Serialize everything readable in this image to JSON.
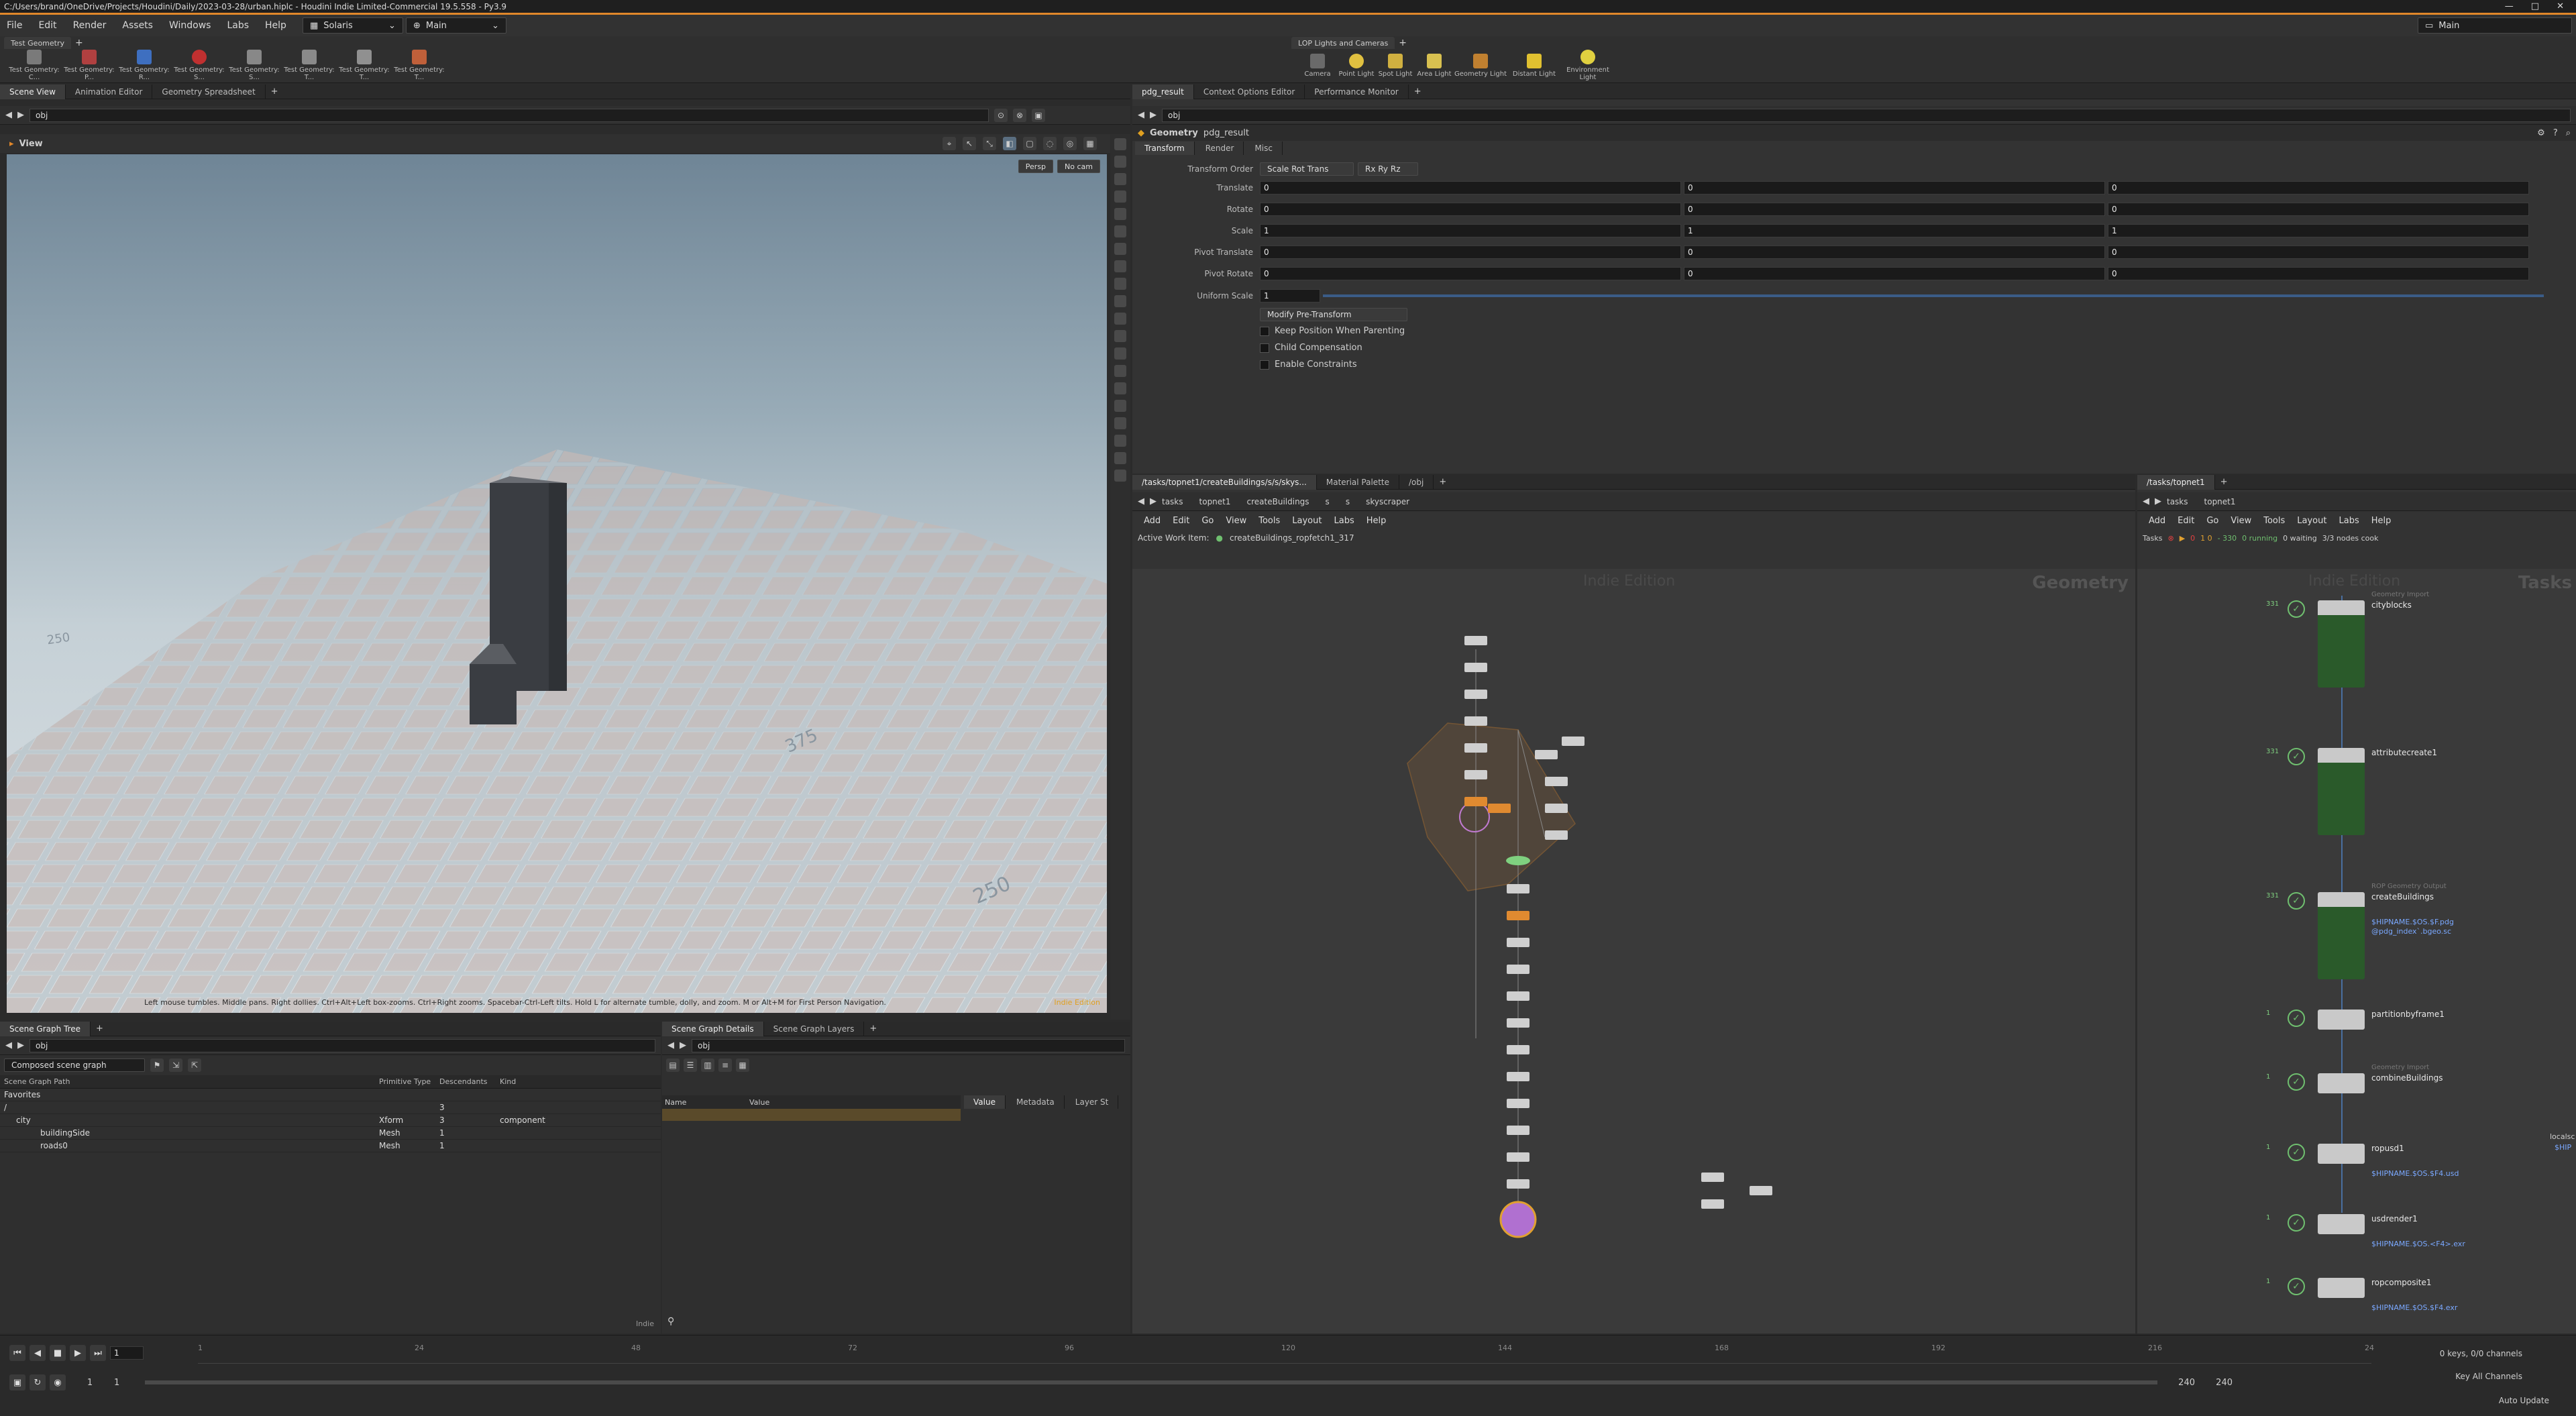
{
  "window": {
    "title": "C:/Users/brand/OneDrive/Projects/Houdini/Daily/2023-03-28/urban.hiplc - Houdini Indie Limited-Commercial 19.5.558 - Py3.9",
    "workspace": "Main"
  },
  "menubar": {
    "items": [
      "File",
      "Edit",
      "Render",
      "Assets",
      "Windows",
      "Labs",
      "Help"
    ],
    "context": "Solaris",
    "desktop": "Main"
  },
  "shelf_left": {
    "tab": "Test Geometry",
    "tools": [
      "Test Geometry: C...",
      "Test Geometry: P...",
      "Test Geometry: R...",
      "Test Geometry: S...",
      "Test Geometry: S...",
      "Test Geometry: T...",
      "Test Geometry: T...",
      "Test Geometry: T..."
    ]
  },
  "shelf_right": {
    "tab": "LOP Lights and Cameras",
    "tools": [
      "Camera",
      "Point Light",
      "Spot Light",
      "Area Light",
      "Geometry Light",
      "Distant Light",
      "Environment Light"
    ]
  },
  "scene_view": {
    "tabs": [
      "Scene View",
      "Animation Editor",
      "Geometry Spreadsheet"
    ],
    "path": "obj",
    "view_label": "View",
    "persp": "Persp",
    "cam": "No cam",
    "help": "Left mouse tumbles. Middle pans. Right dollies. Ctrl+Alt+Left box-zooms. Ctrl+Right zooms. Spacebar-Ctrl-Left tilts. Hold L for alternate tumble, dolly, and zoom.    M or Alt+M for First Person Navigation.",
    "indie": "Indie Edition",
    "grid_labels": [
      "250",
      "375",
      "250"
    ]
  },
  "params": {
    "tabs": [
      "pdg_result",
      "Context Options Editor",
      "Performance Monitor"
    ],
    "path": "obj",
    "node_type": "Geometry",
    "node_name": "pdg_result",
    "subtabs": [
      "Transform",
      "Render",
      "Misc"
    ],
    "transform_order_label": "Transform Order",
    "transform_order": "Scale Rot Trans",
    "rot_order": "Rx Ry Rz",
    "rows": [
      {
        "label": "Translate",
        "v": [
          "0",
          "0",
          "0"
        ]
      },
      {
        "label": "Rotate",
        "v": [
          "0",
          "0",
          "0"
        ]
      },
      {
        "label": "Scale",
        "v": [
          "1",
          "1",
          "1"
        ]
      },
      {
        "label": "Pivot Translate",
        "v": [
          "0",
          "0",
          "0"
        ]
      },
      {
        "label": "Pivot Rotate",
        "v": [
          "0",
          "0",
          "0"
        ]
      }
    ],
    "uniform_label": "Uniform Scale",
    "uniform": "1",
    "modify": "Modify Pre-Transform",
    "checks": [
      "Keep Position When Parenting",
      "Child Compensation",
      "Enable Constraints"
    ]
  },
  "network": {
    "tabs": [
      "/tasks/topnet1/createBuildings/s/s/skys...",
      "Material Palette",
      "/obj"
    ],
    "crumbs": [
      "tasks",
      "topnet1",
      "createBuildings",
      "s",
      "s",
      "skyscraper"
    ],
    "menu": [
      "Add",
      "Edit",
      "Go",
      "View",
      "Tools",
      "Layout",
      "Labs",
      "Help"
    ],
    "active_label": "Active Work Item:",
    "active_item": "createBuildings_ropfetch1_317",
    "watermark": "Indie Edition",
    "context": "Geometry"
  },
  "tasks": {
    "tab": "/tasks/topnet1",
    "crumbs": [
      "tasks",
      "topnet1"
    ],
    "menu": [
      "Add",
      "Edit",
      "Go",
      "View",
      "Tools",
      "Layout",
      "Labs",
      "Help"
    ],
    "label": "Tasks",
    "x": "0",
    "stats": [
      "0",
      "1  0",
      "-  330",
      "0 running",
      "0 waiting",
      "3/3 nodes cook"
    ],
    "watermark": "Indie Edition",
    "context": "Tasks",
    "nodes": [
      {
        "count": "331",
        "type": "Geometry Import",
        "name": "cityblocks",
        "sub": ""
      },
      {
        "count": "331",
        "type": "",
        "name": "attributecreate1",
        "sub": ""
      },
      {
        "count": "331",
        "type": "ROP Geometry Output",
        "name": "createBuildings",
        "sub": "$HIPNAME.$OS.$F.pdg",
        "sub2": "@pdg_index`.bgeo.sc"
      },
      {
        "count": "1",
        "type": "",
        "name": "partitionbyframe1",
        "sub": ""
      },
      {
        "count": "1",
        "type": "Geometry Import",
        "name": "combineBuildings",
        "sub": ""
      },
      {
        "count": "1",
        "type": "",
        "name": "ropusd1",
        "sub": "$HIPNAME.$OS.$F4.usd"
      },
      {
        "count": "1",
        "type": "",
        "name": "usdrender1",
        "sub": "$HIPNAME.$OS.<F4>.exr"
      },
      {
        "count": "1",
        "type": "",
        "name": "ropcomposite1",
        "sub": "$HIPNAME.$OS.$F4.exr"
      }
    ],
    "side": [
      "localsc",
      "$HIP"
    ]
  },
  "scene_graph": {
    "tabs": [
      "Scene Graph Tree"
    ],
    "path": "obj",
    "mode": "Composed scene graph",
    "cols": [
      "Scene Graph Path",
      "Primitive Type",
      "Descendants",
      "Kind"
    ],
    "rows": [
      {
        "name": "Favorites",
        "type": "",
        "desc": "",
        "kind": ""
      },
      {
        "name": "/",
        "type": "",
        "desc": "3",
        "kind": ""
      },
      {
        "name": "city",
        "type": "Xform",
        "desc": "3",
        "kind": "component"
      },
      {
        "name": "buildingSide",
        "type": "Mesh",
        "desc": "1",
        "kind": ""
      },
      {
        "name": "roads0",
        "type": "Mesh",
        "desc": "1",
        "kind": ""
      }
    ],
    "foot": "Indie"
  },
  "details": {
    "tabs": [
      "Scene Graph Details",
      "Scene Graph Layers"
    ],
    "path": "obj",
    "cols": [
      "Name",
      "Value"
    ],
    "right_tabs": [
      "Value",
      "Metadata",
      "Layer St"
    ]
  },
  "timeline": {
    "ticks": [
      "1",
      "24",
      "48",
      "72",
      "96",
      "120",
      "144",
      "168",
      "192",
      "216",
      "24"
    ],
    "frame": "1",
    "start": "1",
    "start2": "1",
    "end": "240",
    "end2": "240",
    "keys": "0 keys, 0/0 channels",
    "key_all": "Key All Channels",
    "auto": "Auto Update"
  }
}
